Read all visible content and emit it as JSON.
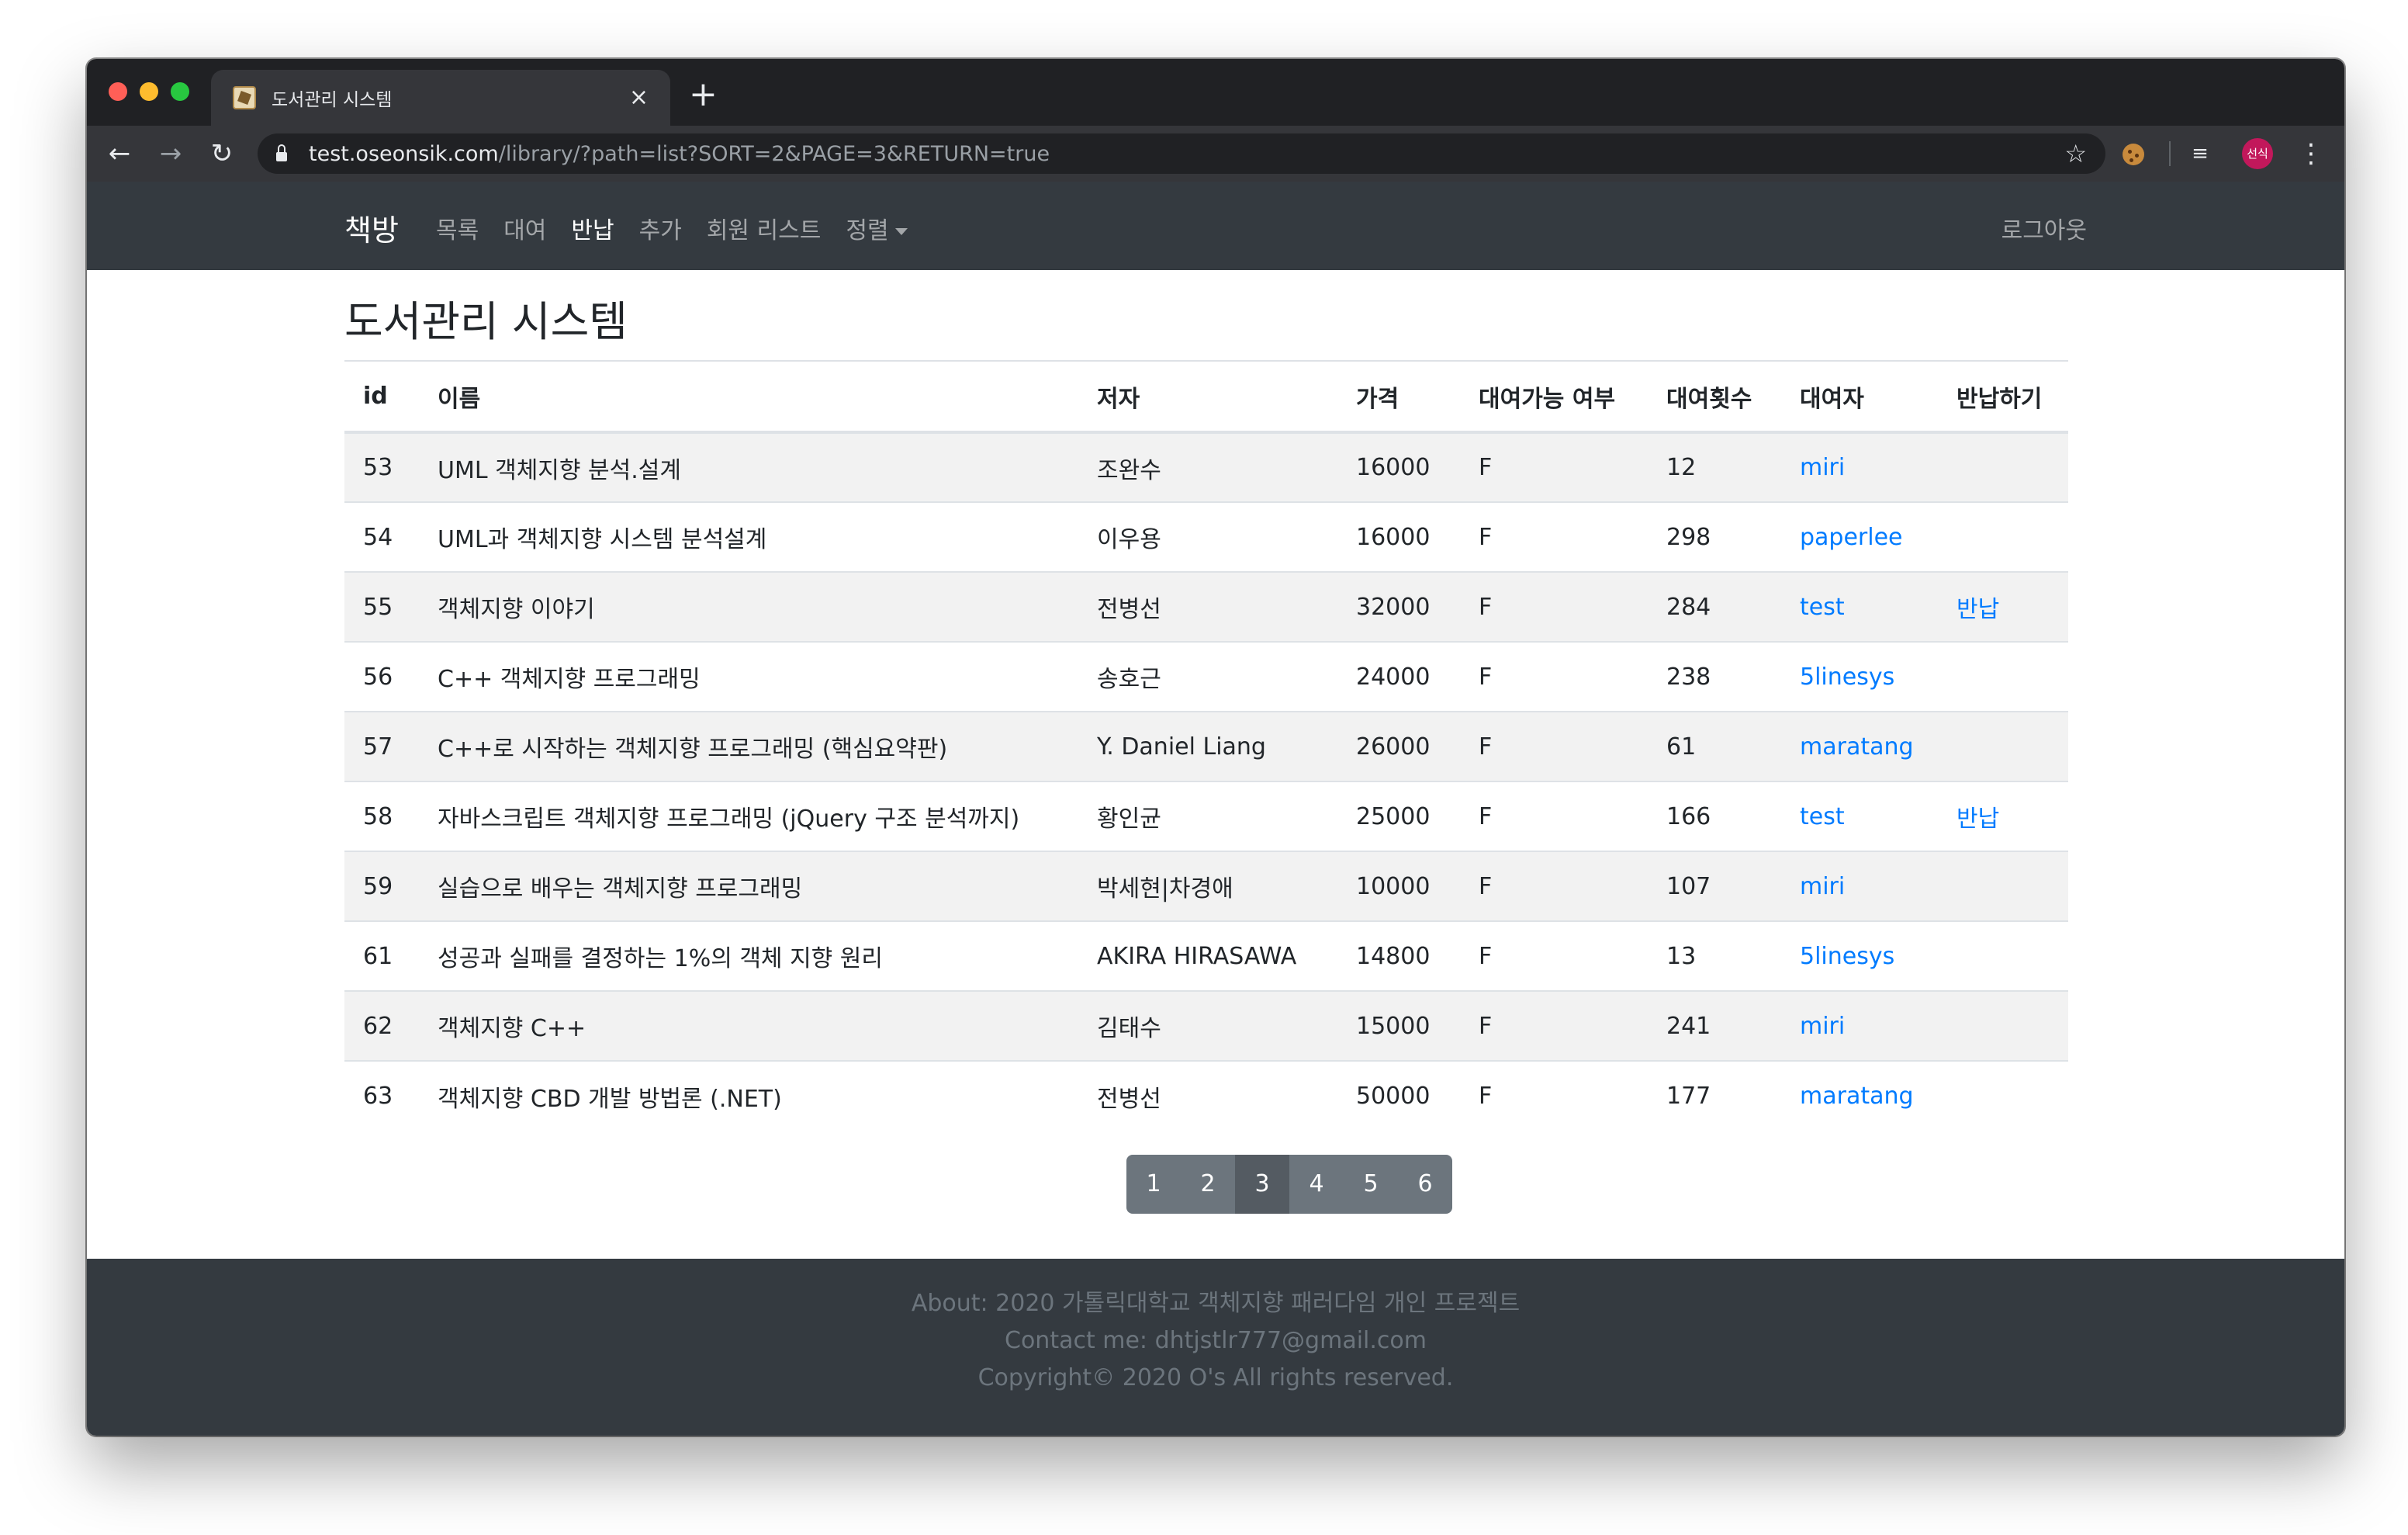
{
  "browser": {
    "tab_title": "도서관리 시스템",
    "tab_close": "×",
    "new_tab": "+",
    "url_host": "test.oseonsik.com",
    "url_path": "/library/?path=list?SORT=2&PAGE=3&RETURN=true",
    "profile_initials": "선식",
    "icons": [
      "back-arrow-icon",
      "forward-arrow-icon",
      "reload-icon",
      "lock-icon",
      "star-icon",
      "cookie-icon",
      "media-queue-icon",
      "kebab-menu-icon"
    ]
  },
  "navbar": {
    "brand": "책방",
    "links": [
      "목록",
      "대여",
      "반납",
      "추가",
      "회원 리스트",
      "정렬"
    ],
    "active_link": "반납",
    "logout": "로그아웃"
  },
  "main": {
    "title": "도서관리 시스템",
    "table": {
      "columns": [
        "id",
        "이름",
        "저자",
        "가격",
        "대여가능 여부",
        "대여횟수",
        "대여자",
        "반납하기"
      ],
      "rows": [
        {
          "id": "53",
          "name": "UML 객체지향 분석.설계",
          "author": "조완수",
          "price": "16000",
          "available": "F",
          "count": "12",
          "borrower": "miri",
          "return": ""
        },
        {
          "id": "54",
          "name": "UML과 객체지향 시스템 분석설계",
          "author": "이우용",
          "price": "16000",
          "available": "F",
          "count": "298",
          "borrower": "paperlee",
          "return": ""
        },
        {
          "id": "55",
          "name": "객체지향 이야기",
          "author": "전병선",
          "price": "32000",
          "available": "F",
          "count": "284",
          "borrower": "test",
          "return": "반납"
        },
        {
          "id": "56",
          "name": "C++ 객체지향 프로그래밍",
          "author": "송호근",
          "price": "24000",
          "available": "F",
          "count": "238",
          "borrower": "5linesys",
          "return": ""
        },
        {
          "id": "57",
          "name": "C++로 시작하는 객체지향 프로그래밍 (핵심요약판)",
          "author": "Y. Daniel Liang",
          "price": "26000",
          "available": "F",
          "count": "61",
          "borrower": "maratang",
          "return": ""
        },
        {
          "id": "58",
          "name": "자바스크립트 객체지향 프로그래밍 (jQuery 구조 분석까지)",
          "author": "황인균",
          "price": "25000",
          "available": "F",
          "count": "166",
          "borrower": "test",
          "return": "반납"
        },
        {
          "id": "59",
          "name": "실습으로 배우는 객체지향 프로그래밍",
          "author": "박세현|차경애",
          "price": "10000",
          "available": "F",
          "count": "107",
          "borrower": "miri",
          "return": ""
        },
        {
          "id": "61",
          "name": "성공과 실패를 결정하는 1%의 객체 지향 원리",
          "author": "AKIRA HIRASAWA",
          "price": "14800",
          "available": "F",
          "count": "13",
          "borrower": "5linesys",
          "return": ""
        },
        {
          "id": "62",
          "name": "객체지향 C++",
          "author": "김태수",
          "price": "15000",
          "available": "F",
          "count": "241",
          "borrower": "miri",
          "return": ""
        },
        {
          "id": "63",
          "name": "객체지향 CBD 개발 방법론 (.NET)",
          "author": "전병선",
          "price": "50000",
          "available": "F",
          "count": "177",
          "borrower": "maratang",
          "return": ""
        }
      ]
    },
    "pagination": {
      "pages": [
        "1",
        "2",
        "3",
        "4",
        "5",
        "6"
      ],
      "current": "3"
    }
  },
  "footer": {
    "about": "About: 2020 가톨릭대학교 객체지향 패러다임 개인 프로젝트",
    "contact": "Contact me: dhtjstlr777@gmail.com",
    "copyright": "Copyright© 2020 O's All rights reserved."
  },
  "colors": {
    "navbar_bg": "#343a40",
    "link": "#007bff",
    "pagination_bg": "#6c757d",
    "pagination_active": "#545b62"
  }
}
